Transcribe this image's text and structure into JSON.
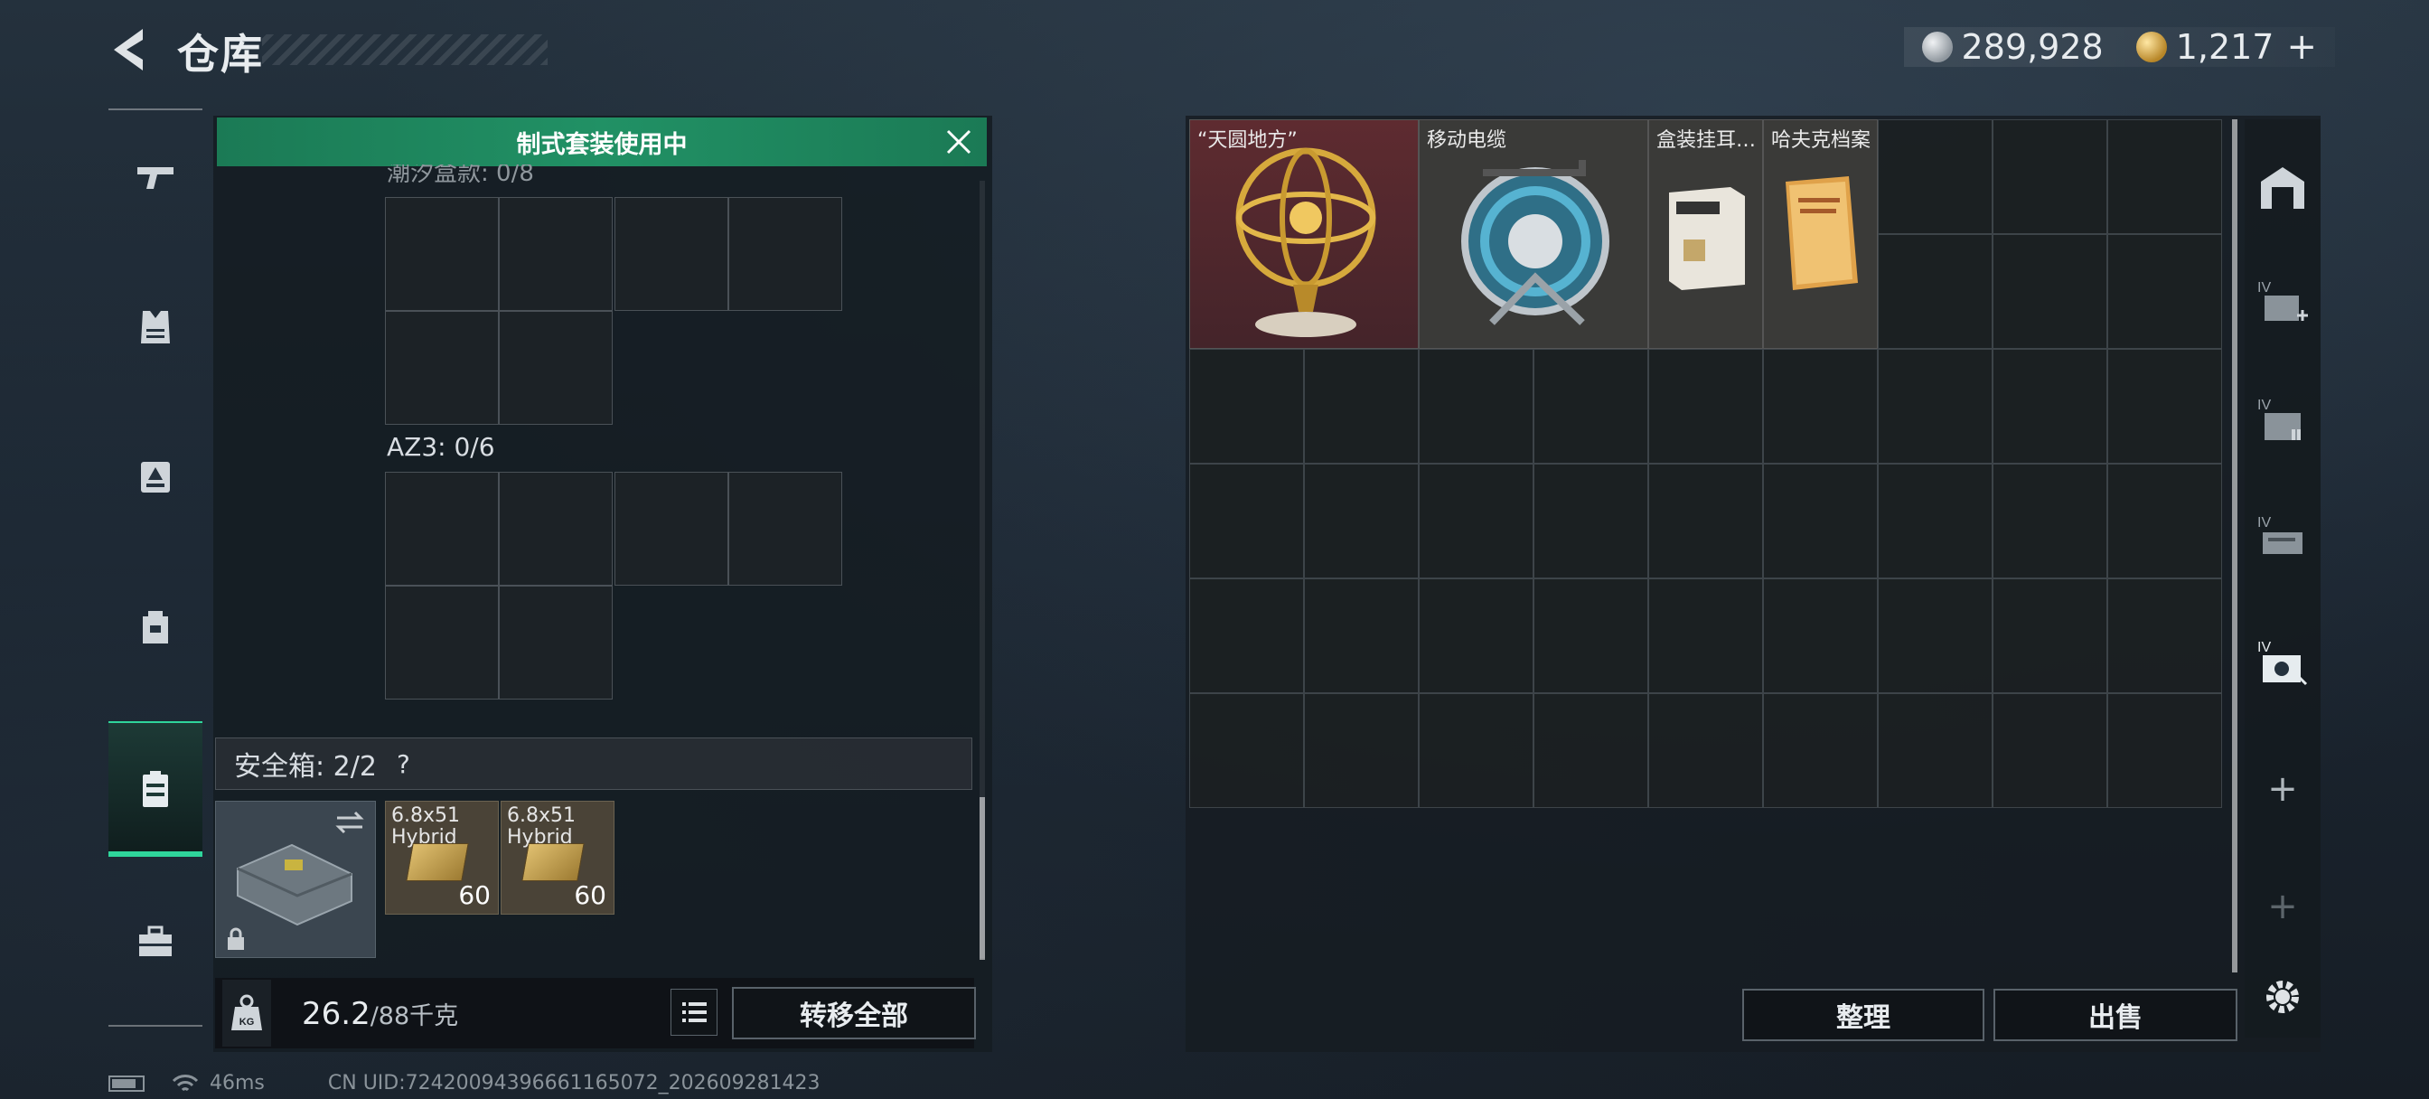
{
  "header": {
    "title": "仓库",
    "currency_silver": "289,928",
    "currency_gold": "1,217",
    "plus_label": "+"
  },
  "left_nav": {
    "items": [
      {
        "name": "weapon",
        "icon": "pistol-icon"
      },
      {
        "name": "armor",
        "icon": "vest-icon"
      },
      {
        "name": "chest-rig",
        "icon": "rig-icon"
      },
      {
        "name": "backpack",
        "icon": "backpack-icon"
      },
      {
        "name": "safe-box",
        "icon": "safe-case-icon",
        "active": true
      },
      {
        "name": "toolbox",
        "icon": "toolbox-icon"
      }
    ]
  },
  "loadout_panel": {
    "banner": "制式套装使用中",
    "partial_label": "潮汐盒款: 0/8",
    "az3_label": "AZ3: 0/6",
    "safe_box_label": "安全箱: 2/2",
    "safe_box_help": "?",
    "ammo": [
      {
        "name_line1": "6.8x51",
        "name_line2": "Hybrid",
        "count": "60"
      },
      {
        "name_line1": "6.8x51",
        "name_line2": "Hybrid",
        "count": "60"
      }
    ],
    "weight": "26.2",
    "weight_max": "/88千克",
    "transfer_all": "转移全部"
  },
  "warehouse": {
    "items": [
      {
        "label": "“天圆地方”",
        "bg": "#5a2a2e"
      },
      {
        "label": "移动电缆",
        "bg": "#3a3a38"
      },
      {
        "label": "盒装挂耳…",
        "bg": "#3a3a38"
      },
      {
        "label": "哈夫克档案",
        "bg": "#3a3a38"
      }
    ],
    "sort_button": "整理",
    "sell_button": "出售"
  },
  "side_nav": {
    "tiers": [
      "IV",
      "IV",
      "IV",
      "IV"
    ]
  },
  "status_bar": {
    "ping": "46ms",
    "uid": "CN UID:72420094396661165072_202609281423"
  }
}
